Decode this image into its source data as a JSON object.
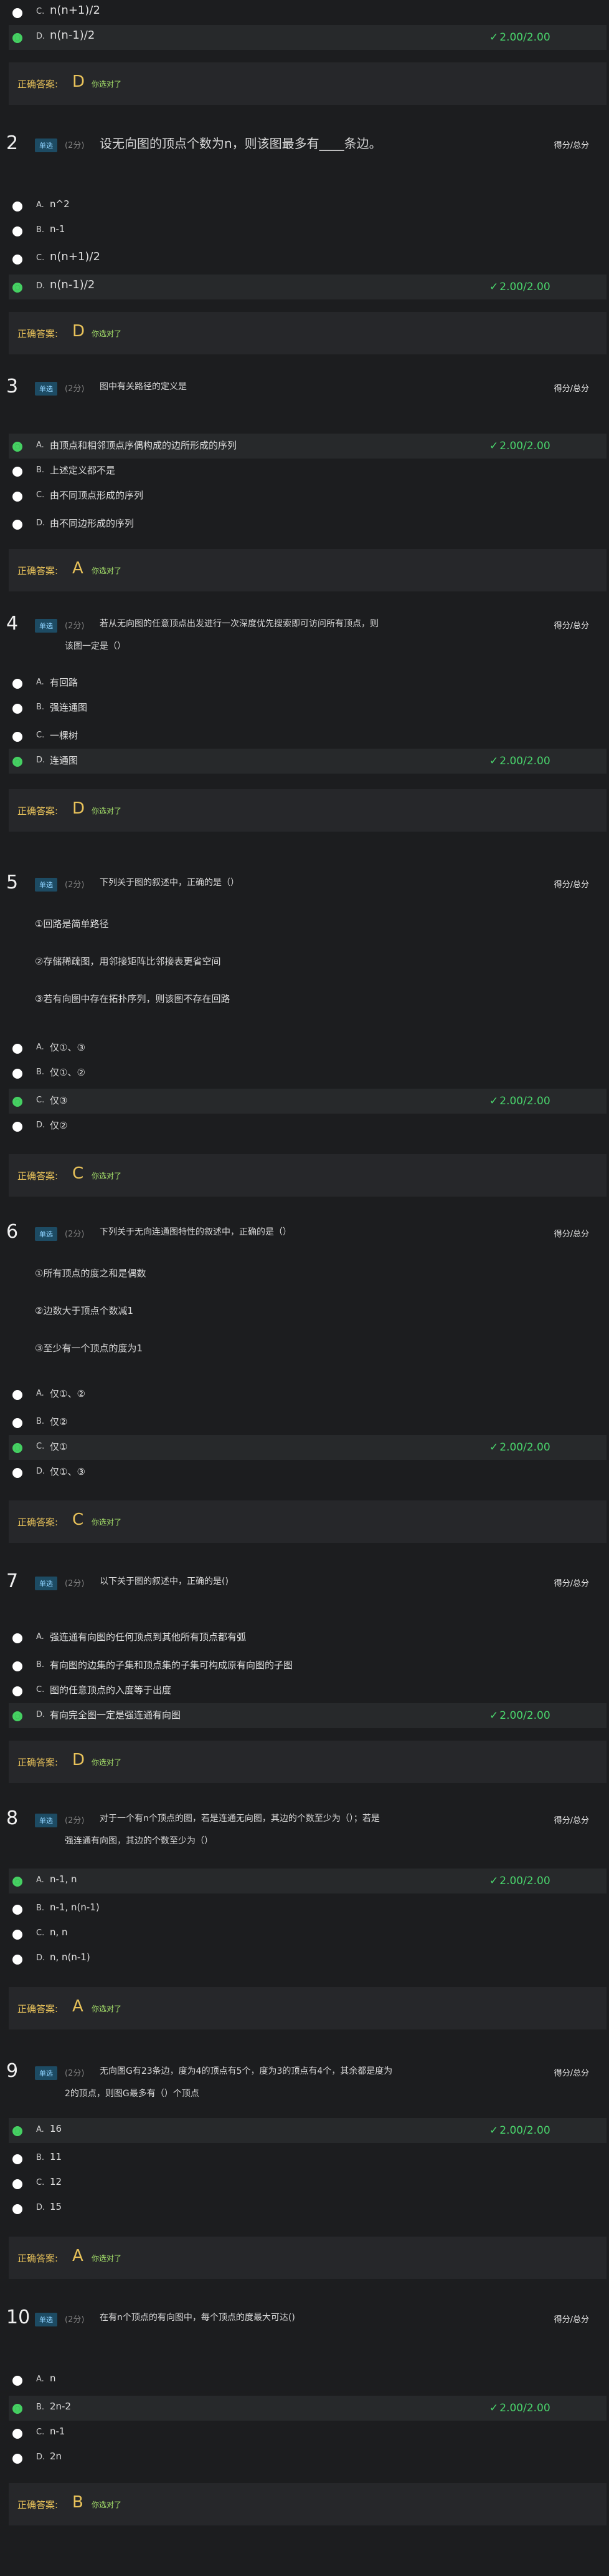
{
  "questions": [
    {
      "tail": true,
      "options": [
        {
          "letter": "C.",
          "text": "n(n+1)/2",
          "big": true,
          "selected": false
        },
        {
          "letter": "D.",
          "text": "n(n-1)/2",
          "big": true,
          "selected": true,
          "mark": "2.00/2.00"
        }
      ],
      "answer": {
        "label": "正确答案:",
        "value": "D",
        "result": "你选对了"
      }
    },
    {
      "num": "2",
      "type": "单选",
      "score": "(2分)",
      "score_right": "得分/总分",
      "title": "设无向图的顶点个数为n，则该图最多有____条边。",
      "title_big": true,
      "options": [
        {
          "letter": "A.",
          "text": "n^2",
          "selected": false
        },
        {
          "letter": "B.",
          "text": "n-1",
          "selected": false
        },
        {
          "letter": "C.",
          "text": "n(n+1)/2",
          "big": true,
          "selected": false
        },
        {
          "letter": "D.",
          "text": "n(n-1)/2",
          "big": true,
          "selected": true,
          "mark": "2.00/2.00"
        }
      ],
      "answer": {
        "label": "正确答案:",
        "value": "D",
        "result": "你选对了"
      }
    },
    {
      "num": "3",
      "type": "单选",
      "score": "(2分)",
      "score_right": "得分/总分",
      "title": "图中有关路径的定义是",
      "options": [
        {
          "letter": "A.",
          "text": "由顶点和相邻顶点序偶构成的边所形成的序列",
          "selected": true,
          "mark": "2.00/2.00"
        },
        {
          "letter": "B.",
          "text": "上述定义都不是",
          "selected": false
        },
        {
          "letter": "C.",
          "text": "由不同顶点形成的序列",
          "selected": false
        },
        {
          "letter": "D.",
          "text": "由不同边形成的序列",
          "selected": false
        }
      ],
      "answer": {
        "label": "正确答案:",
        "value": "A",
        "result": "你选对了"
      }
    },
    {
      "num": "4",
      "type": "单选",
      "score": "(2分)",
      "score_right": "得分/总分",
      "title": "若从无向图的任意顶点出发进行一次深度优先搜索即可访问所有顶点，则",
      "title2": "该图一定是（）",
      "options": [
        {
          "letter": "A.",
          "text": "有回路",
          "selected": false
        },
        {
          "letter": "B.",
          "text": "强连通图",
          "selected": false
        },
        {
          "letter": "C.",
          "text": "一棵树",
          "selected": false
        },
        {
          "letter": "D.",
          "text": "连通图",
          "selected": true,
          "mark": "2.00/2.00"
        }
      ],
      "answer": {
        "label": "正确答案:",
        "value": "D",
        "result": "你选对了"
      }
    },
    {
      "num": "5",
      "type": "单选",
      "score": "(2分)",
      "score_right": "得分/总分",
      "title": "下列关于图的叙述中，正确的是（）",
      "stems": [
        "①回路是简单路径",
        "②存储稀疏图，用邻接矩阵比邻接表更省空间",
        "③若有向图中存在拓扑序列，则该图不存在回路"
      ],
      "options": [
        {
          "letter": "A.",
          "text": "仅①、③",
          "selected": false
        },
        {
          "letter": "B.",
          "text": "仅①、②",
          "selected": false
        },
        {
          "letter": "C.",
          "text": "仅③",
          "selected": true,
          "mark": "2.00/2.00"
        },
        {
          "letter": "D.",
          "text": "仅②",
          "selected": false
        }
      ],
      "answer": {
        "label": "正确答案:",
        "value": "C",
        "result": "你选对了"
      }
    },
    {
      "num": "6",
      "type": "单选",
      "score": "(2分)",
      "score_right": "得分/总分",
      "title": "下列关于无向连通图特性的叙述中，正确的是（）",
      "stems": [
        "①所有顶点的度之和是偶数",
        "②边数大于顶点个数减1",
        "③至少有一个顶点的度为1"
      ],
      "options": [
        {
          "letter": "A.",
          "text": "仅①、②",
          "selected": false
        },
        {
          "letter": "B.",
          "text": "仅②",
          "selected": false
        },
        {
          "letter": "C.",
          "text": "仅①",
          "selected": true,
          "mark": "2.00/2.00"
        },
        {
          "letter": "D.",
          "text": "仅①、③",
          "selected": false
        }
      ],
      "answer": {
        "label": "正确答案:",
        "value": "C",
        "result": "你选对了"
      }
    },
    {
      "num": "7",
      "type": "单选",
      "score": "(2分)",
      "score_right": "得分/总分",
      "title": "以下关于图的叙述中，正确的是()",
      "options": [
        {
          "letter": "A.",
          "text": "强连通有向图的任何顶点到其他所有顶点都有弧",
          "selected": false
        },
        {
          "letter": "B.",
          "text": "有向图的边集的子集和顶点集的子集可构成原有向图的子图",
          "selected": false
        },
        {
          "letter": "C.",
          "text": "图的任意顶点的入度等于出度",
          "selected": false
        },
        {
          "letter": "D.",
          "text": "有向完全图一定是强连通有向图",
          "selected": true,
          "mark": "2.00/2.00"
        }
      ],
      "answer": {
        "label": "正确答案:",
        "value": "D",
        "result": "你选对了"
      }
    },
    {
      "num": "8",
      "type": "单选",
      "score": "(2分)",
      "score_right": "得分/总分",
      "title": "对于一个有n个顶点的图，若是连通无向图，其边的个数至少为（）；若是",
      "title2": "强连通有向图，其边的个数至少为（）",
      "options": [
        {
          "letter": "A.",
          "text": "n-1, n",
          "selected": true,
          "mark": "2.00/2.00"
        },
        {
          "letter": "B.",
          "text": "n-1, n(n-1)",
          "selected": false
        },
        {
          "letter": "C.",
          "text": "n, n",
          "selected": false
        },
        {
          "letter": "D.",
          "text": "n, n(n-1)",
          "selected": false
        }
      ],
      "answer": {
        "label": "正确答案:",
        "value": "A",
        "result": "你选对了"
      }
    },
    {
      "num": "9",
      "type": "单选",
      "score": "(2分)",
      "score_right": "得分/总分",
      "title": "无向图G有23条边，度为4的顶点有5个，度为3的顶点有4个，其余都是度为",
      "title2": "2的顶点，则图G最多有（）个顶点",
      "options": [
        {
          "letter": "A.",
          "text": "16",
          "selected": true,
          "mark": "2.00/2.00"
        },
        {
          "letter": "B.",
          "text": "11",
          "selected": false
        },
        {
          "letter": "C.",
          "text": "12",
          "selected": false
        },
        {
          "letter": "D.",
          "text": "15",
          "selected": false
        }
      ],
      "answer": {
        "label": "正确答案:",
        "value": "A",
        "result": "你选对了"
      }
    },
    {
      "num": "10",
      "type": "单选",
      "score": "(2分)",
      "score_right": "得分/总分",
      "title": "在有n个顶点的有向图中，每个顶点的度最大可达()",
      "options": [
        {
          "letter": "A.",
          "text": "n",
          "selected": false
        },
        {
          "letter": "B.",
          "text": "2n-2",
          "selected": true,
          "mark": "2.00/2.00"
        },
        {
          "letter": "C.",
          "text": "n-1",
          "selected": false
        },
        {
          "letter": "D.",
          "text": "2n",
          "selected": false
        }
      ],
      "answer": {
        "label": "正确答案:",
        "value": "B",
        "result": "你选对了"
      }
    }
  ],
  "colors": {
    "accent_green": "#45d062",
    "answer_gold": "#e8c25a",
    "result_green": "#a6e26b",
    "tag_bg": "#1d4b63"
  }
}
